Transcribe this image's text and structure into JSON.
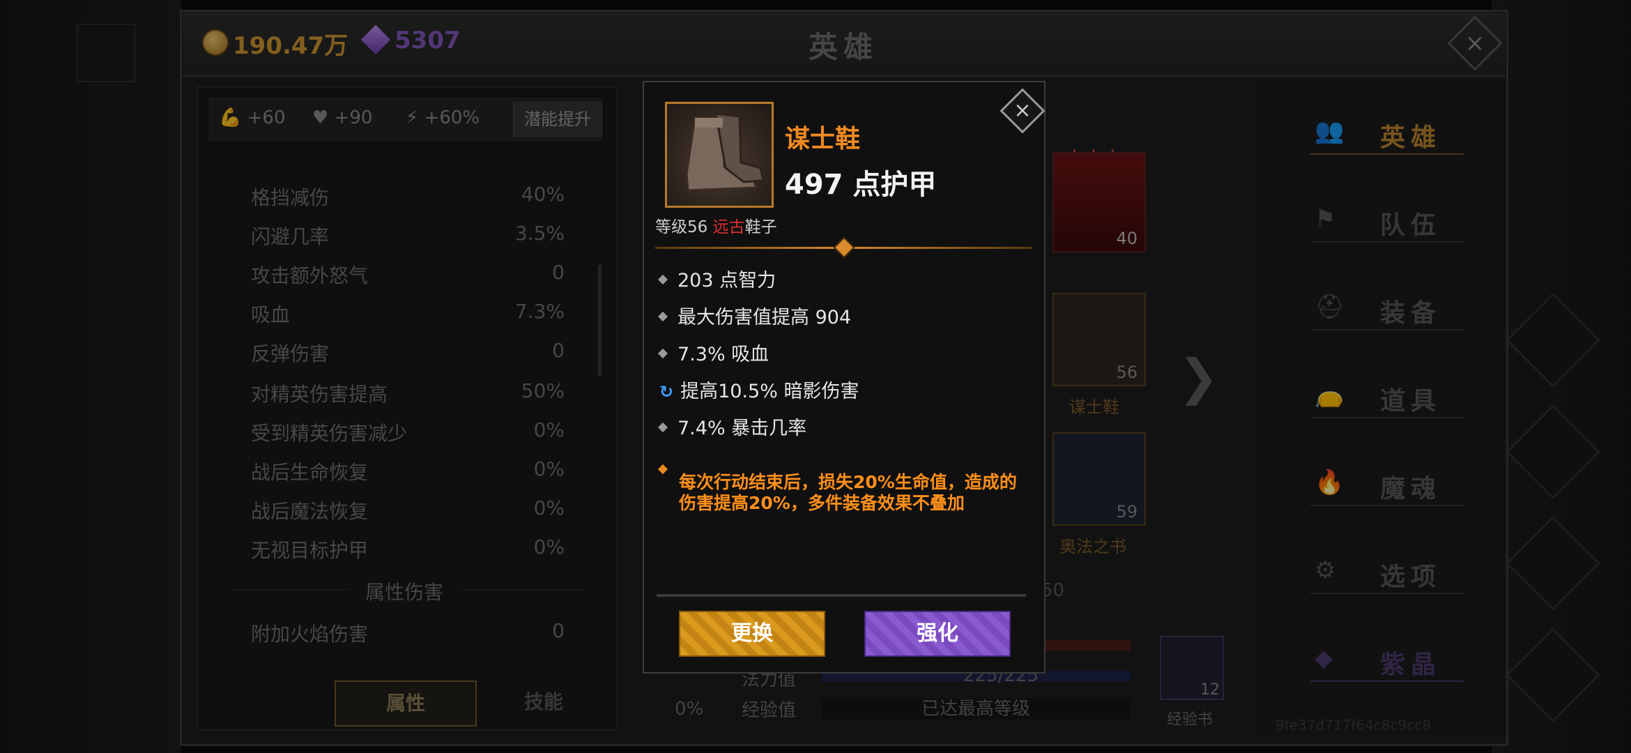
{
  "currency": {
    "gold": "190.47万",
    "gems": "5307"
  },
  "window_title": "英雄",
  "left_panel": {
    "bonuses": [
      {
        "icon": "strength-arm-icon",
        "value": "+60"
      },
      {
        "icon": "heart-icon",
        "value": "+90"
      },
      {
        "icon": "lightning-icon",
        "value": "+60%"
      }
    ],
    "potential_button": "潜能提升",
    "stats": [
      {
        "label": "格挡减伤",
        "value": "40%"
      },
      {
        "label": "闪避几率",
        "value": "3.5%"
      },
      {
        "label": "攻击额外怒气",
        "value": "0"
      },
      {
        "label": "吸血",
        "value": "7.3%"
      },
      {
        "label": "反弹伤害",
        "value": "0"
      },
      {
        "label": "对精英伤害提高",
        "value": "50%"
      },
      {
        "label": "受到精英伤害减少",
        "value": "0%"
      },
      {
        "label": "战后生命恢复",
        "value": "0%"
      },
      {
        "label": "战后魔法恢复",
        "value": "0%"
      },
      {
        "label": "无视目标护甲",
        "value": "0%"
      }
    ],
    "section_title": "属性伤害",
    "elemental": [
      {
        "label": "附加火焰伤害",
        "value": "0"
      }
    ],
    "tabs": {
      "attributes": "属性",
      "skills": "技能"
    }
  },
  "hero_area": {
    "hero_level": "40",
    "boots_level": "56",
    "boots_name": "谋士鞋",
    "book_level": "59",
    "book_name": "奥法之书",
    "partial_number": "50",
    "mana_label": "法力值",
    "mana_value": "225/225",
    "exp_label": "经验值",
    "exp_value": "已达最高等级",
    "percent": "0%",
    "exp_book_count": "12",
    "exp_book_label": "经验书"
  },
  "right_nav": [
    {
      "icon": "hero-icon",
      "label": "英雄"
    },
    {
      "icon": "flag-icon",
      "label": "队伍"
    },
    {
      "icon": "helmet-icon",
      "label": "装备"
    },
    {
      "icon": "bag-icon",
      "label": "道具"
    },
    {
      "icon": "flame-icon",
      "label": "魔魂"
    },
    {
      "icon": "gear-icon",
      "label": "选项"
    },
    {
      "icon": "crystal-icon",
      "label": "紫晶"
    }
  ],
  "watermark": "9fe37d717f64c8c9cc8",
  "popup": {
    "item_name": "谋士鞋",
    "armor": "497 点护甲",
    "level_prefix": "等级56",
    "rarity": "远古",
    "slot_type": "鞋子",
    "affixes": [
      {
        "type": "normal",
        "text": "203 点智力"
      },
      {
        "type": "normal",
        "text": "最大伤害值提高 904"
      },
      {
        "type": "normal",
        "text": "7.3% 吸血"
      },
      {
        "type": "rerolled",
        "text": "提高10.5% 暗影伤害"
      },
      {
        "type": "normal",
        "text": "7.4% 暴击几率"
      },
      {
        "type": "legendary",
        "text": "每次行动结束后，损失20%生命值，造成的伤害提高20%，多件装备效果不叠加"
      }
    ],
    "replace_button": "更换",
    "enhance_button": "强化"
  }
}
